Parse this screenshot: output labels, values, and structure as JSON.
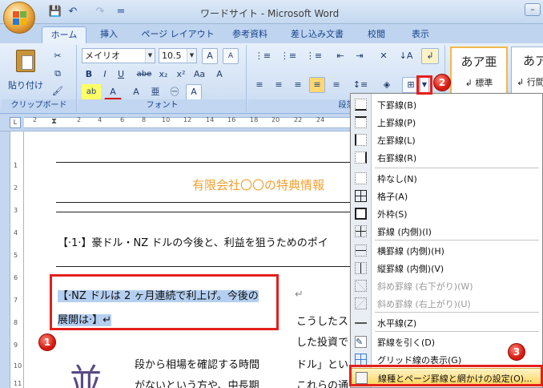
{
  "window": {
    "title": "ワードサイト - Microsoft Word"
  },
  "quick_access": {
    "save": "💾",
    "undo": "↶",
    "redo": "↷",
    "more": "="
  },
  "tabs": [
    "ホーム",
    "挿入",
    "ページ レイアウト",
    "参考資料",
    "差し込み文書",
    "校閲",
    "表示"
  ],
  "ribbon": {
    "clipboard": {
      "paste_label": "貼り付け",
      "group_label": "クリップボード"
    },
    "font": {
      "name": "メイリオ",
      "size": "10.5",
      "group_label": "フォント",
      "bold": "B",
      "italic": "I",
      "underline": "U",
      "strike": "abe",
      "sub": "x₂",
      "sup": "x²",
      "aa": "Aa",
      "clear": "A",
      "highlight": "ab",
      "color": "A",
      "grow": "A",
      "shrink": "A",
      "ruby": "亜",
      "enclose": "㊀",
      "border_a": "A"
    },
    "paragraph": {
      "group_label": "段落"
    },
    "styles": [
      {
        "sample": "あア亜",
        "name": "↲ 標準"
      },
      {
        "sample": "あア",
        "name": "↲ 行間詰"
      }
    ]
  },
  "ruler": {
    "h_numbers": [
      "2",
      "2",
      "4",
      "6",
      "8",
      "10",
      "12",
      "14",
      "16",
      "18",
      "20",
      "22",
      "24"
    ],
    "v_numbers": [
      "1",
      "2",
      "3",
      "4",
      "5",
      "6",
      "7",
      "8",
      "9",
      "10",
      "11"
    ]
  },
  "document": {
    "title": "有限会社〇〇の特典情報",
    "heading1": "【·1·】豪ドル・NZ ドルの今後と、利益を狙うためのポイ",
    "sel_line1": "【·NZ ドルは 2 ヶ月連続で利上げ。今後の",
    "sel_line2": "展開は·】↵",
    "col2_1": "こうしたス",
    "col2_2": "した投資で",
    "col2_3": "ドル」とい",
    "col2_4": "これらの通",
    "body1": "段から相場を確認する時間",
    "body2": "がないという方や、中長期",
    "big_char": "並",
    "return_mark": "↵"
  },
  "menu": {
    "items": [
      {
        "label": "下罫線(B)",
        "enabled": true,
        "icon": "bottom-border-icon"
      },
      {
        "label": "上罫線(P)",
        "enabled": true,
        "icon": "top-border-icon"
      },
      {
        "label": "左罫線(L)",
        "enabled": true,
        "icon": "left-border-icon"
      },
      {
        "label": "右罫線(R)",
        "enabled": true,
        "icon": "right-border-icon"
      },
      {
        "label": "枠なし(N)",
        "enabled": true,
        "icon": "no-border-icon"
      },
      {
        "label": "格子(A)",
        "enabled": true,
        "icon": "all-borders-icon"
      },
      {
        "label": "外枠(S)",
        "enabled": true,
        "icon": "outside-borders-icon"
      },
      {
        "label": "罫線 (内側)(I)",
        "enabled": true,
        "icon": "inside-borders-icon"
      },
      {
        "label": "横罫線 (内側)(H)",
        "enabled": true,
        "icon": "inside-horizontal-border-icon"
      },
      {
        "label": "縦罫線 (内側)(V)",
        "enabled": true,
        "icon": "inside-vertical-border-icon"
      },
      {
        "label": "斜め罫線 (右下がり)(W)",
        "enabled": false,
        "icon": "diagonal-down-border-icon"
      },
      {
        "label": "斜め罫線 (右上がり)(U)",
        "enabled": false,
        "icon": "diagonal-up-border-icon"
      },
      {
        "label": "水平線(Z)",
        "enabled": true,
        "icon": "horizontal-line-icon"
      },
      {
        "label": "罫線を引く(D)",
        "enabled": true,
        "icon": "draw-table-icon"
      },
      {
        "label": "グリッド線の表示(G)",
        "enabled": true,
        "icon": "view-gridlines-icon"
      },
      {
        "label": "線種とページ罫線と網かけの設定(O)...",
        "enabled": true,
        "icon": "borders-shading-icon"
      }
    ]
  },
  "callouts": [
    "1",
    "2",
    "3"
  ],
  "colors": {
    "accent_red": "#e3201b",
    "title_orange": "#f0a030",
    "selection": "#b4cff0"
  }
}
